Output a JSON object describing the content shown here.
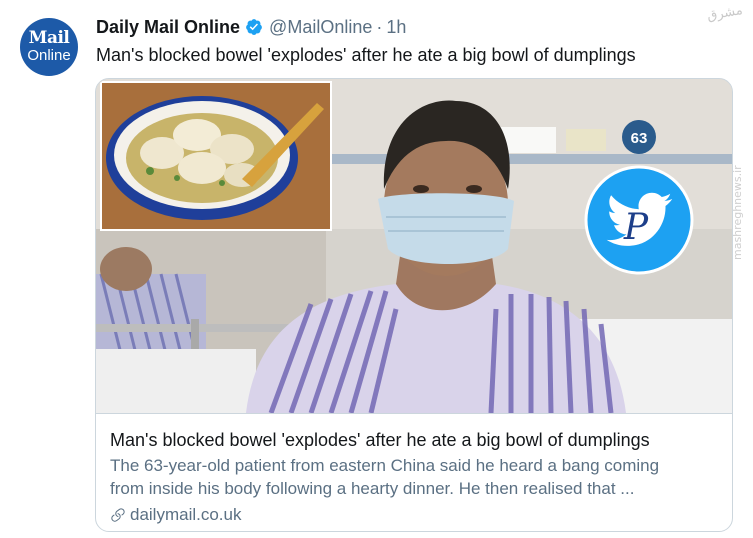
{
  "author": {
    "avatar_line1": "Mail",
    "avatar_line2": "Online",
    "name": "Daily Mail Online",
    "handle": "@MailOnline",
    "separator": "·",
    "time": "1h"
  },
  "tweet": {
    "text": "Man's blocked bowel 'explodes' after he ate a big bowl of dumplings"
  },
  "card": {
    "title": "Man's blocked bowel 'explodes' after he ate a big bowl of dumplings",
    "description_line1": "The 63-year-old patient from eastern China said he heard a bang coming",
    "description_line2": "from inside his body following a hearty dinner. He then realised that ...",
    "domain": "dailymail.co.uk",
    "image_sign": "63"
  },
  "overlays": {
    "corner_watermark": "مشرق",
    "side_watermark": "mashreghnews.ir"
  },
  "icons": {
    "verified": "verified-badge-icon",
    "link": "link-icon",
    "twitter_logo": "twitter-bird-icon"
  },
  "colors": {
    "brand_blue": "#1d5aa8",
    "verified_blue": "#1da1f2",
    "secondary_text": "#5b7083",
    "border": "#ccd6dd"
  }
}
